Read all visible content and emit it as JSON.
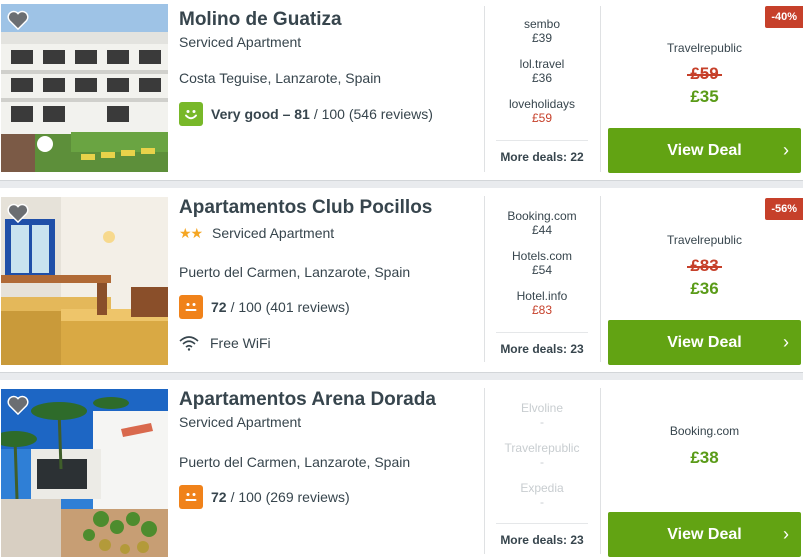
{
  "hotels": [
    {
      "name": "Molino de Guatiza",
      "stars": "",
      "type": "Serviced Apartment",
      "location": "Costa Teguise, Lanzarote, Spain",
      "rating_word": "Very good – 81",
      "rating_rest": "/ 100 (546 reviews)",
      "rating_color": "#78b829",
      "rating_face": "happy",
      "amenity": "",
      "deals": [
        {
          "provider": "sembo",
          "price": "£39",
          "red": false
        },
        {
          "provider": "lol.travel",
          "price": "£36",
          "red": false
        },
        {
          "provider": "loveholidays",
          "price": "£59",
          "red": true
        }
      ],
      "more_deals": "More deals: 22",
      "best_provider": "Travelrepublic",
      "old_price": "£59",
      "new_price": "£35",
      "discount": "-40%",
      "view_deal": "View Deal"
    },
    {
      "name": "Apartamentos Club Pocillos",
      "stars": "★★",
      "type": "Serviced Apartment",
      "location": "Puerto del Carmen, Lanzarote, Spain",
      "rating_word": "72",
      "rating_rest": "/ 100 (401 reviews)",
      "rating_color": "#f0821a",
      "rating_face": "neutral",
      "amenity": "Free WiFi",
      "deals": [
        {
          "provider": "Booking.com",
          "price": "£44",
          "red": false
        },
        {
          "provider": "Hotels.com",
          "price": "£54",
          "red": false
        },
        {
          "provider": "Hotel.info",
          "price": "£83",
          "red": true
        }
      ],
      "more_deals": "More deals: 23",
      "best_provider": "Travelrepublic",
      "old_price": "£83",
      "new_price": "£36",
      "discount": "-56%",
      "view_deal": "View Deal"
    },
    {
      "name": "Apartamentos Arena Dorada",
      "stars": "",
      "type": "Serviced Apartment",
      "location": "Puerto del Carmen, Lanzarote, Spain",
      "rating_word": "72",
      "rating_rest": "/ 100 (269 reviews)",
      "rating_color": "#f0821a",
      "rating_face": "neutral",
      "amenity": "",
      "deals": [
        {
          "provider": "Elvoline",
          "price": "-",
          "red": false
        },
        {
          "provider": "Travelrepublic",
          "price": "-",
          "red": false
        },
        {
          "provider": "Expedia",
          "price": "-",
          "red": false
        }
      ],
      "more_deals": "More deals: 23",
      "best_provider": "Booking.com",
      "old_price": "",
      "new_price": "£38",
      "discount": "",
      "view_deal": "View Deal"
    }
  ],
  "icons": {
    "favorite": "heart-icon",
    "wifi": "wifi-icon",
    "chevron": "chevron-right-icon"
  }
}
